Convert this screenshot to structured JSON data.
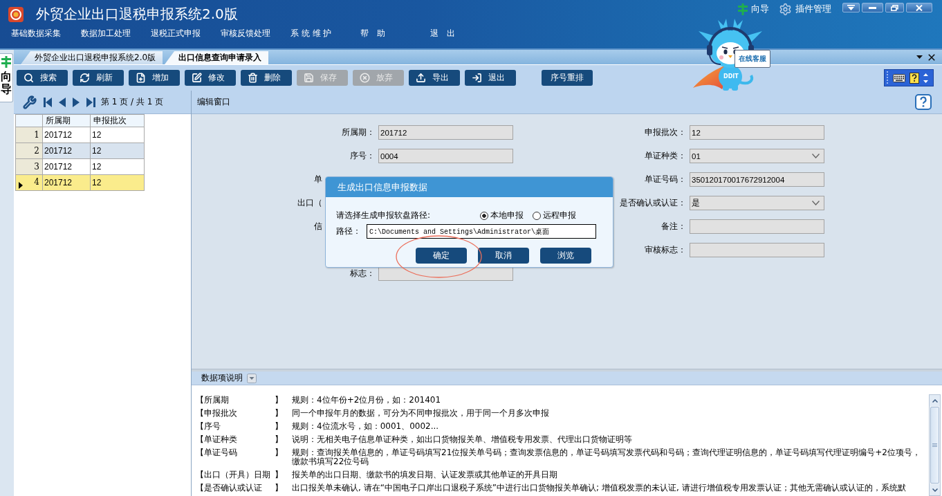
{
  "window": {
    "title": "外贸企业出口退税申报系统2.0版",
    "links": [
      {
        "label": "向导"
      },
      {
        "label": "插件管理"
      }
    ]
  },
  "menu": [
    {
      "label": "基础数据采集"
    },
    {
      "label": "数据加工处理"
    },
    {
      "label": "退税正式申报"
    },
    {
      "label": "审核反馈处理"
    },
    {
      "label": "系 统 维 护"
    },
    {
      "label": "帮　助"
    },
    {
      "label": "退　出"
    }
  ],
  "side_tab": {
    "label": "向导"
  },
  "assistant": {
    "sign": "在线客服",
    "badge": "DDIT"
  },
  "tabs": [
    {
      "label": "外贸企业出口退税申报系统2.0版",
      "selected": false
    },
    {
      "label": "出口信息查询申请录入",
      "selected": true
    }
  ],
  "toolbar": {
    "buttons": [
      {
        "label": "搜索",
        "disabled": false
      },
      {
        "label": "刷新",
        "disabled": false
      },
      {
        "label": "增加",
        "disabled": false
      },
      {
        "label": "修改",
        "disabled": false
      },
      {
        "label": "删除",
        "disabled": false
      },
      {
        "label": "保存",
        "disabled": true
      },
      {
        "label": "放弃",
        "disabled": true
      },
      {
        "label": "导出",
        "disabled": false
      },
      {
        "label": "退出",
        "disabled": false
      }
    ],
    "side_buttons": [
      {
        "label": "序号重排",
        "disabled": false
      }
    ]
  },
  "pager": {
    "text": "第 1 页 / 共 1 页"
  },
  "grid": {
    "columns": [
      "所属期",
      "申报批次"
    ],
    "rows": [
      {
        "number": "1",
        "cells": [
          "201712",
          "12"
        ],
        "selected": false
      },
      {
        "number": "2",
        "cells": [
          "201712",
          "12"
        ],
        "selected": false
      },
      {
        "number": "3",
        "cells": [
          "201712",
          "12"
        ],
        "selected": false
      },
      {
        "number": "4",
        "cells": [
          "201712",
          "12"
        ],
        "selected": true
      }
    ]
  },
  "editor": {
    "title": "编辑窗口",
    "left_fields": [
      {
        "label": "所属期：",
        "value": "201712",
        "kind": "text"
      },
      {
        "label": "序号：",
        "value": "0004",
        "kind": "text"
      },
      {
        "label": "单",
        "kind": "covered"
      },
      {
        "label": "出口（",
        "kind": "covered"
      },
      {
        "label": "信",
        "kind": "covered"
      },
      {
        "label": "标志：",
        "kind": "text"
      }
    ],
    "right_fields": [
      {
        "label": "申报批次：",
        "value": "12",
        "kind": "text"
      },
      {
        "label": "单证种类：",
        "value": "01",
        "kind": "select"
      },
      {
        "label": "单证号码：",
        "value": "350120170017672912004",
        "kind": "text"
      },
      {
        "label": "是否确认或认证：",
        "value": "是",
        "kind": "select"
      },
      {
        "label": "备注：",
        "kind": "text"
      },
      {
        "label": "审核标志：",
        "kind": "text"
      }
    ]
  },
  "dialog": {
    "title": "生成出口信息申报数据",
    "prompt": "请选择生成申报软盘路径:",
    "options": [
      {
        "label": "本地申报",
        "selected": true
      },
      {
        "label": "远程申报",
        "selected": false
      }
    ],
    "path_label": "路径：",
    "path": "C:\\Documents and Settings\\Administrator\\桌面",
    "buttons": [
      {
        "label": "确定"
      },
      {
        "label": "取消"
      },
      {
        "label": "浏览"
      }
    ]
  },
  "help": {
    "title": "数据项说明",
    "rows": [
      {
        "label": "【所属期",
        "bracket": "】",
        "text": "规则：4位年份+2位月份，如：201401"
      },
      {
        "label": "【申报批次",
        "bracket": "】",
        "text": "同一个申报年月的数据，可分为不同申报批次，用于同一个月多次申报"
      },
      {
        "label": "【序号",
        "bracket": "】",
        "text": "规则：4位流水号，如：0001、0002..."
      },
      {
        "label": "【单证种类",
        "bracket": "】",
        "text": "说明：无相关电子信息单证种类，如出口货物报关单、增值税专用发票、代理出口货物证明等"
      },
      {
        "label": "【单证号码",
        "bracket": "】",
        "text": "规则：查询报关单信息的，单证号码填写21位报关单号码；查询发票信息的，单证号码填写发票代码和号码；查询代理证明信息的，单证号码填写代理证明编号+2位项号，缴款书填写22位号码"
      },
      {
        "label": "【出口（开具）日期",
        "bracket": "】",
        "text": "报关单的出口日期、缴款书的填发日期、认证发票或其他单证的开具日期"
      },
      {
        "label": "【是否确认或认证",
        "bracket": "】",
        "text": "出口报关单未确认, 请在“中国电子口岸出口退税子系统”中进行出口货物报关单确认; 增值税发票的未认证, 请进行增值税专用发票认证；其他无需确认或认证的，系统默"
      }
    ]
  }
}
